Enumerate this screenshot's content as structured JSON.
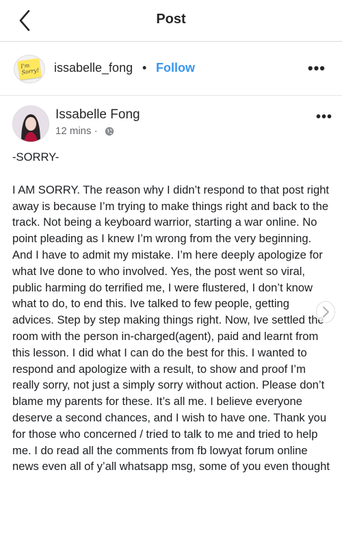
{
  "header": {
    "title": "Post"
  },
  "poster": {
    "username": "issabelle_fong",
    "separator": "•",
    "follow_label": "Follow",
    "avatar_text": "I'm Sorry!"
  },
  "post": {
    "author": "Issabelle Fong",
    "time": "12 mins ·",
    "heading": "-SORRY-",
    "body": "I AM SORRY. The reason why I didn’t respond to that post right away is because I’m trying to make things right and back to the track. Not being a keyboard warrior, starting a war online. No point pleading as I knew I’m wrong from the very beginning. And I have to admit my mistake. I’m here deeply apologize for what Ive done to who involved. Yes, the post went so viral, public harming do terrified me, I were flustered, I don’t know what to do, to end this. Ive talked to few people, getting advices. Step by step making things right. Now, Ive settled the room with the person in-charged(agent), paid and learnt from this lesson. I did what I can do the best for this. I wanted to respond and apologize with a result, to show and proof I’m really sorry, not just a simply sorry without action. Please don’t blame my parents for these. It’s all me. I believe everyone deserve a second chances, and I wish to have one. Thank you for those who concerned / tried to talk to me and tried to help me. I do read all the comments from fb lowyat forum online news even all of y’all whatsapp msg, some of you even thought"
  },
  "icons": {
    "back": "chevron-left-icon",
    "more": "more-horizontal-icon",
    "globe": "globe-icon",
    "next": "chevron-right-icon"
  },
  "colors": {
    "follow": "#3897f0",
    "text": "#262626",
    "meta": "#65676b"
  }
}
